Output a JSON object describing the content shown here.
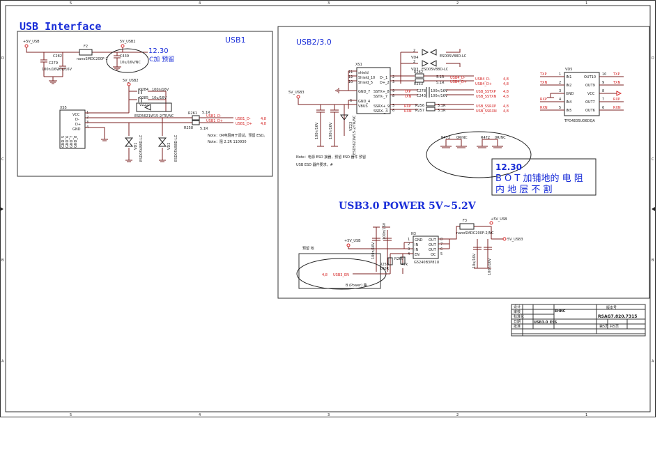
{
  "sheet": {
    "title": "USB Interface",
    "col_labels": [
      "5",
      "4",
      "3",
      "2",
      "1"
    ],
    "row_labels": [
      "D",
      "C",
      "B",
      "A"
    ]
  },
  "usb1": {
    "title": "USB1",
    "net_5v": "+5V_USB",
    "net_5v_usb2": "5V_USB2",
    "fuse_ref": "F2",
    "fuse_part": "nanoSMDC200F-2",
    "cap_c282": "C282",
    "cap_c279": "C279",
    "cap_c279_val": "100n/16V",
    "cap_c282_val": "10u/16V",
    "cap_c439": "C439",
    "cap_c439_val": "10u/16V/NC",
    "note_date": "12.30",
    "note_text": "C加 预留",
    "net_5v_usb2_b": "5V_USB2",
    "cap_c284": "C284",
    "cap_c284_val": "100n/16V",
    "cap_c285": "C285",
    "cap_c285_val": "10u/16V",
    "esd_ref": "VZ22",
    "esd_part": "ESD5621W15-2/TR/NC",
    "conn_ref": "XS5",
    "conn_pins": [
      "VCC",
      "D-",
      "D+",
      "GND"
    ],
    "conn_pin_nums": [
      "1",
      "2",
      "3",
      "4"
    ],
    "conn_gnd_pins": [
      "GND_5",
      "GND_6",
      "GND_7",
      "GND_8"
    ],
    "r261": "R261",
    "r261_val": "5.1R",
    "r258": "R258",
    "r258_val": "5.1R",
    "net_dm": "USB1_D-",
    "net_dp": "USB1_D+",
    "net_ref_dm": "4,8",
    "net_ref_dp": "4,8",
    "vd1_ref": "VD1",
    "vd1_part": "ESD05V88D-LC",
    "vd2_ref": "VD2",
    "vd2_part": "ESD05V88D-LC",
    "note1": "Note：0R电阻用于调试，预留 ESD。",
    "note2": "Note：阻 2.2R 110930"
  },
  "usb23": {
    "title": "USB2/3.0",
    "conn_ref": "XS1",
    "conn_pins_left": [
      "shield",
      "Shield_10",
      "Shield_5",
      "GND_7",
      "GND_4",
      "VBUS"
    ],
    "conn_pins_right": [
      "D-_1",
      "D+_2",
      "SSTX+_8",
      "SSTX-_7",
      "SSRX+_9",
      "SSRX-_4"
    ],
    "conn_left_nums": [
      "11",
      "12",
      "10",
      "6"
    ],
    "conn_right_nums": [
      "2",
      "3",
      "9",
      "8",
      "5",
      "6"
    ],
    "net_5v_usb3": "5V_USB3",
    "vd3_ref": "VD3",
    "vd4_ref": "VD4",
    "vd_part": "ESD05V88D-LC",
    "r262": "R262",
    "r253": "R253",
    "r_val": "5.1R",
    "net_usb4_dm": "USB4_D-",
    "net_usb4_dp": "USB4_D+",
    "net_ref": "4,8",
    "c278": "C278",
    "c243": "C243",
    "c_val": "100n/16V",
    "txp": "TXP",
    "txn": "TXN",
    "rxp": "RXP",
    "rxn": "RXN",
    "net_sstxp": "USB_SSTXP",
    "net_sstxn": "USB_SSTXN",
    "net_ssrxp": "USB_SSRXP",
    "net_ssrxn": "USB_SSRXN",
    "r256": "R256",
    "r257": "R257",
    "vz23_ref": "VZ23",
    "vz23_part": "ESD5621W15-2/TR/NC",
    "cap_left1": "100n/16V",
    "cap_left2": "100n/16V",
    "r473": "R473",
    "r472": "R472",
    "r_nc": "0R/NC",
    "note1": "Note：电源 ESD 接器，预留 ESD 器件 预留",
    "note2": "USB ESD 器件要求，#",
    "bot_date": "12.30",
    "bot_line1": "B O T 加铺地的 电 阻",
    "bot_line2": "内 地 层 不 割"
  },
  "tpd": {
    "ref": "VD5",
    "part": "TPD4E05U06DQA",
    "pins_left": [
      "IN1",
      "IN2",
      "GND",
      "IN4",
      "IN5"
    ],
    "pins_right": [
      "OUT10",
      "OUT9",
      "VCC",
      "OUT7",
      "OUT6"
    ],
    "nums_left": [
      "1",
      "2",
      "3",
      "4",
      "5"
    ],
    "nums_right": [
      "10",
      "9",
      "8",
      "7",
      "6"
    ],
    "nets_left": [
      "TXP",
      "TXN",
      "",
      "RXP",
      "RXN"
    ],
    "nets_right": [
      "TXP",
      "TXN",
      "",
      "RXP",
      "RXN"
    ]
  },
  "power": {
    "title": "USB3.0 POWER 5V~5.2V",
    "net_in": "+5V_USB",
    "net_in2": "+5V_USB",
    "ic_ref": "N3",
    "ic_part": "G5240B3P81U",
    "ic_pins_left": [
      "GND",
      "IN",
      "IN",
      "EN"
    ],
    "ic_pins_right": [
      "OUT",
      "OUT",
      "OUT",
      "OC"
    ],
    "ic_nums_left": [
      "1",
      "2",
      "3",
      "4"
    ],
    "ic_nums_right": [
      "8",
      "7",
      "6",
      "5"
    ],
    "fuse_ref": "F3",
    "fuse_part": "nanoSMDC200F-2/NC",
    "net_out": "5V_USB3",
    "r259": "R259",
    "r259_val": "100R",
    "r260": "R260",
    "r260_val": "47k",
    "c_in1": "100n/16V",
    "c_in2": "100n/16V",
    "c_out1": "10u/16V",
    "c_out2": "100n/16V",
    "en_ref": "4,8",
    "en_net": "USB3_EN",
    "en_note": "预留 地",
    "en_note2": "B (Power) 路"
  },
  "title_block": {
    "company": "EHNC",
    "doc_no": "RSAG7.820.7315",
    "sheet_title": "USB3.0_ESS",
    "rows": [
      "设计",
      "审核",
      "标准化",
      "日期",
      "批准"
    ],
    "ver": "版本号",
    "page": "第5页  共5页"
  }
}
